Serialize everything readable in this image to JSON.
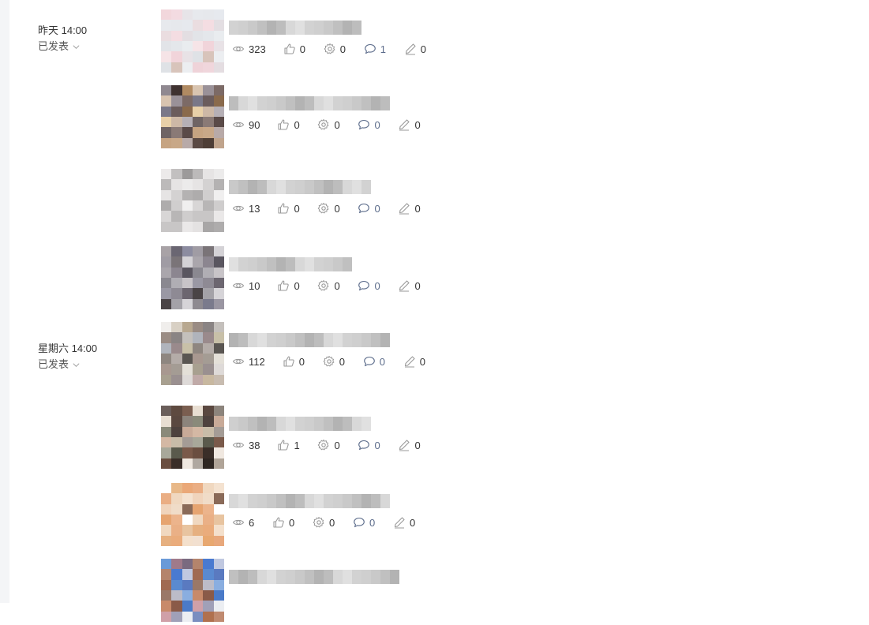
{
  "groups": [
    {
      "time": "昨天 14:00",
      "status": "已发表"
    },
    {
      "time": "星期六 14:00",
      "status": "已发表"
    }
  ],
  "articles": [
    {
      "views": "323",
      "likes": "0",
      "shares": "0",
      "comments": "1",
      "edits": "0"
    },
    {
      "views": "90",
      "likes": "0",
      "shares": "0",
      "comments": "0",
      "edits": "0"
    },
    {
      "views": "13",
      "likes": "0",
      "shares": "0",
      "comments": "0",
      "edits": "0"
    },
    {
      "views": "10",
      "likes": "0",
      "shares": "0",
      "comments": "0",
      "edits": "0"
    },
    {
      "views": "112",
      "likes": "0",
      "shares": "0",
      "comments": "0",
      "edits": "0"
    },
    {
      "views": "38",
      "likes": "1",
      "shares": "0",
      "comments": "0",
      "edits": "0"
    },
    {
      "views": "6",
      "likes": "0",
      "shares": "0",
      "comments": "0",
      "edits": "0"
    },
    {
      "views": "",
      "likes": "",
      "shares": "",
      "comments": "",
      "edits": ""
    }
  ],
  "icons": {
    "views": "eye-icon",
    "likes": "thumbs-up-icon",
    "shares": "gear-icon",
    "comments": "comment-icon",
    "edits": "pen-icon",
    "status": "chevron-down-icon"
  },
  "colors": {
    "icon": "#9a9a9a",
    "comment_value": "#5b6b8a",
    "rail": "#f4f5f7"
  }
}
